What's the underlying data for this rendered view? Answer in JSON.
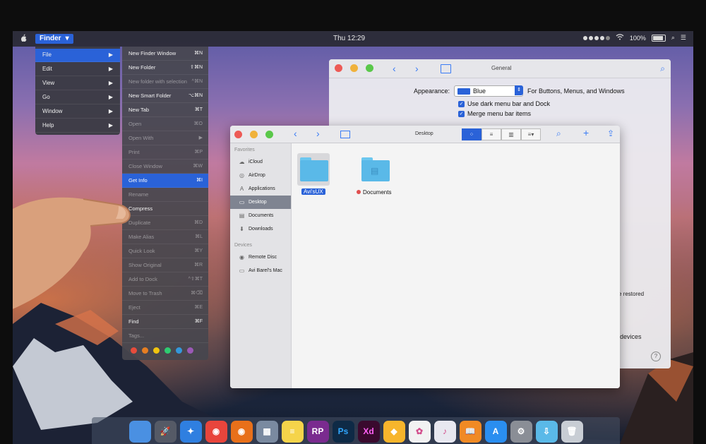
{
  "menubar": {
    "app_menu": "Finder",
    "clock": "Thu 12:29",
    "battery": "100%"
  },
  "finder_menu": {
    "items": [
      {
        "label": "File",
        "arrow": "▶",
        "active": true
      },
      {
        "label": "Edit",
        "arrow": "▶"
      },
      {
        "label": "View",
        "arrow": "▶"
      },
      {
        "label": "Go",
        "arrow": "▶"
      },
      {
        "label": "Window",
        "arrow": "▶"
      },
      {
        "label": "Help",
        "arrow": "▶"
      }
    ]
  },
  "file_menu": {
    "items": [
      {
        "label": "New Finder Window",
        "shortcut": "⌘N"
      },
      {
        "label": "New Folder",
        "shortcut": "⇧⌘N"
      },
      {
        "label": "New folder with selection",
        "shortcut": "^⌘N",
        "dim": true
      },
      {
        "label": "New Smart Folder",
        "shortcut": "⌥⌘N"
      },
      {
        "label": "New Tab",
        "shortcut": "⌘T"
      },
      {
        "label": "Open",
        "shortcut": "⌘O",
        "dim": true
      },
      {
        "label": "Open With",
        "shortcut": "▶",
        "dim": true
      },
      {
        "label": "Print",
        "shortcut": "⌘P",
        "dim": true
      },
      {
        "label": "Close Window",
        "shortcut": "⌘W",
        "dim": true
      },
      {
        "label": "Get Info",
        "shortcut": "⌘I",
        "active": true
      },
      {
        "label": "Rename",
        "shortcut": "",
        "dim": true
      },
      {
        "label": "Compress",
        "shortcut": ""
      },
      {
        "label": "Duplicate",
        "shortcut": "⌘D",
        "dim": true
      },
      {
        "label": "Make Alias",
        "shortcut": "⌘L",
        "dim": true
      },
      {
        "label": "Quick Look",
        "shortcut": "⌘Y",
        "dim": true
      },
      {
        "label": "Show Original",
        "shortcut": "⌘R",
        "dim": true
      },
      {
        "label": "Add to Dock",
        "shortcut": "^⇧⌘T",
        "dim": true
      },
      {
        "label": "Move to Trash",
        "shortcut": "⌘⌫",
        "dim": true
      },
      {
        "label": "Eject",
        "shortcut": "⌘E",
        "dim": true
      },
      {
        "label": "Find",
        "shortcut": "⌘F"
      },
      {
        "label": "Tags...",
        "shortcut": "",
        "dim": true
      }
    ],
    "tag_colors": [
      "#e74c3c",
      "#e67e22",
      "#f1c40f",
      "#2ecc71",
      "#3498db",
      "#9b59b6"
    ]
  },
  "general": {
    "title": "General",
    "appearance_label": "Appearance:",
    "appearance_value": "Blue",
    "appearance_note": "For Buttons, Menus, and Windows",
    "dark_menu": "Use dark menu bar and Dock",
    "merge_menu": "Merge menu bar items",
    "frag_restored": "e restored",
    "frag_devices": "devices",
    "help": "?"
  },
  "finder": {
    "title": "Desktop",
    "favorites_heading": "Favorites",
    "favorites": [
      {
        "label": "iCloud",
        "icon": "cloud-icon"
      },
      {
        "label": "AirDrop",
        "icon": "airdrop-icon"
      },
      {
        "label": "Applications",
        "icon": "applications-icon"
      },
      {
        "label": "Desktop",
        "icon": "desktop-icon",
        "selected": true
      },
      {
        "label": "Documents",
        "icon": "documents-icon"
      },
      {
        "label": "Downloads",
        "icon": "downloads-icon"
      }
    ],
    "devices_heading": "Devices",
    "devices": [
      {
        "label": "Remote Disc",
        "icon": "disc-icon"
      },
      {
        "label": "Avi Barel's Mac",
        "icon": "laptop-icon"
      }
    ],
    "files": [
      {
        "name": "Avi'sUX",
        "selected": true
      },
      {
        "name": "Documents",
        "tag": "red"
      }
    ]
  },
  "dock": {
    "apps": [
      {
        "name": "finder-icon",
        "color": "#4a90e2",
        "glyph": ""
      },
      {
        "name": "launchpad-icon",
        "color": "#555a66",
        "glyph": "🚀"
      },
      {
        "name": "safari-icon",
        "color": "#2f7fe0",
        "glyph": "✦"
      },
      {
        "name": "chrome-icon",
        "color": "#e8453c",
        "glyph": "◉"
      },
      {
        "name": "firefox-icon",
        "color": "#e8701a",
        "glyph": "◉"
      },
      {
        "name": "preview-icon",
        "color": "#7a8aa0",
        "glyph": "▦"
      },
      {
        "name": "notes-icon",
        "color": "#f5d44a",
        "glyph": "≡"
      },
      {
        "name": "rp-icon",
        "color": "#7a2b8f",
        "glyph": "RP"
      },
      {
        "name": "photoshop-icon",
        "color": "#0e2a46",
        "glyph": "Ps"
      },
      {
        "name": "xd-icon",
        "color": "#3a0a2e",
        "glyph": "Xd"
      },
      {
        "name": "sketch-icon",
        "color": "#f7b52c",
        "glyph": "◆"
      },
      {
        "name": "photos-icon",
        "color": "#f2f2f2",
        "glyph": "✿"
      },
      {
        "name": "itunes-icon",
        "color": "#e8e8f0",
        "glyph": "♪"
      },
      {
        "name": "ibooks-icon",
        "color": "#f08a24",
        "glyph": "📖"
      },
      {
        "name": "appstore-icon",
        "color": "#2a8ef0",
        "glyph": "A"
      },
      {
        "name": "system-preferences-icon",
        "color": "#8a8e96",
        "glyph": "⚙"
      },
      {
        "name": "downloads-folder-icon",
        "color": "#5ab9e8",
        "glyph": "⇩"
      },
      {
        "name": "trash-icon",
        "color": "#c8cdd4",
        "glyph": "🗑"
      }
    ]
  }
}
